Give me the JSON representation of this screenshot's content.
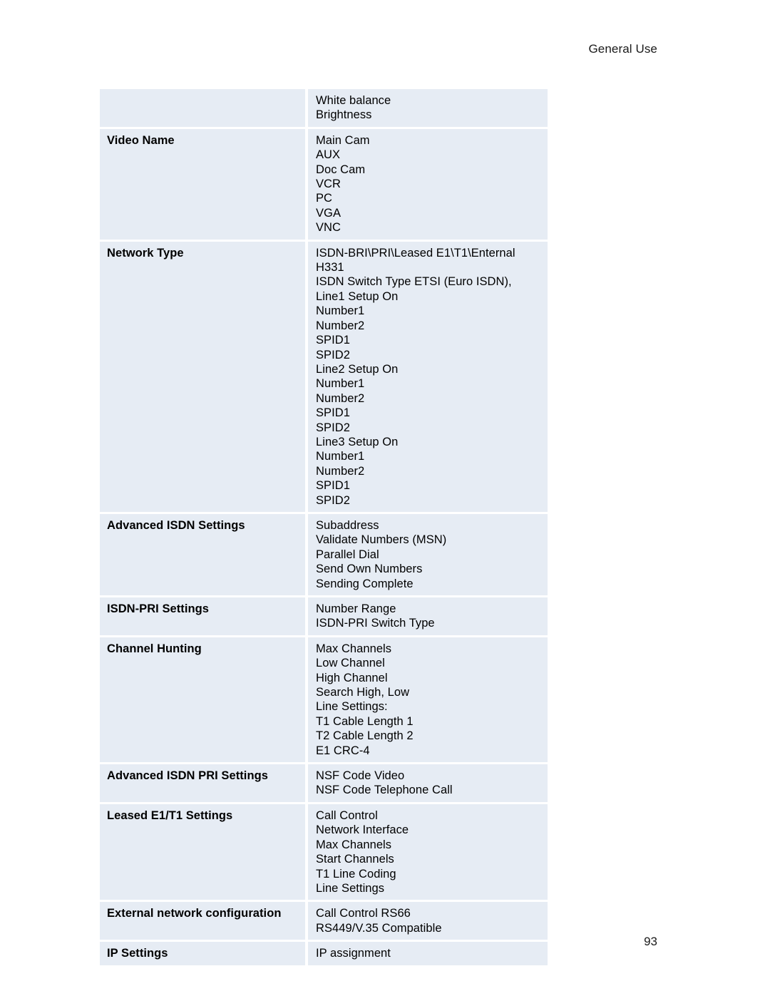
{
  "header": {
    "running_head": "General Use"
  },
  "footer": {
    "page_number": "93"
  },
  "colors": {
    "cell_background": "#e6ecf4",
    "page_background": "#ffffff",
    "text": "#000000"
  },
  "table": {
    "rows": [
      {
        "label": "",
        "values": [
          "White balance",
          "Brightness"
        ]
      },
      {
        "label": "Video Name",
        "values": [
          "Main Cam",
          "AUX",
          "Doc Cam",
          "VCR",
          "PC",
          "VGA",
          "VNC"
        ]
      },
      {
        "label": "Network Type",
        "values": [
          "ISDN-BRI\\PRI\\Leased E1\\T1\\Enternal",
          "H331",
          "ISDN Switch Type ETSI (Euro ISDN),",
          "Line1 Setup On",
          "Number1",
          "Number2",
          "SPID1",
          "SPID2",
          "Line2 Setup On",
          "Number1",
          "Number2",
          "SPID1",
          "SPID2",
          "Line3 Setup On",
          "Number1",
          "Number2",
          "SPID1",
          "SPID2"
        ]
      },
      {
        "label": "Advanced ISDN Settings",
        "values": [
          "Subaddress",
          "Validate Numbers (MSN)",
          "Parallel Dial",
          "Send Own Numbers",
          "Sending Complete"
        ]
      },
      {
        "label": "ISDN-PRI Settings",
        "values": [
          "Number Range",
          "ISDN-PRI Switch Type"
        ]
      },
      {
        "label": "Channel Hunting",
        "values": [
          "Max Channels",
          "Low Channel",
          "High Channel",
          "Search High, Low",
          "Line Settings:",
          "T1 Cable Length 1",
          "T2 Cable Length 2",
          "E1 CRC-4"
        ]
      },
      {
        "label": "Advanced ISDN PRI Settings",
        "values": [
          "NSF Code Video",
          "NSF Code Telephone Call"
        ]
      },
      {
        "label": "Leased E1/T1 Settings",
        "values": [
          "Call Control",
          "Network Interface",
          "Max Channels",
          "Start Channels",
          "T1 Line Coding",
          "Line Settings"
        ]
      },
      {
        "label": "External network configuration",
        "values": [
          "Call Control RS66",
          "RS449/V.35 Compatible"
        ]
      },
      {
        "label": "IP Settings",
        "values": [
          "IP assignment"
        ]
      }
    ]
  }
}
